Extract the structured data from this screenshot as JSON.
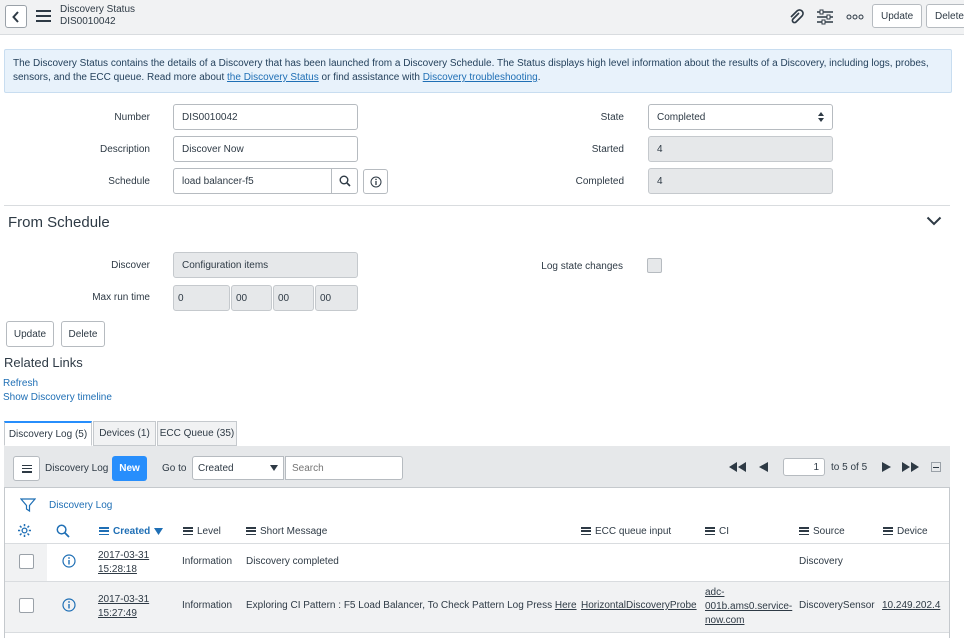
{
  "header": {
    "title": "Discovery Status",
    "subtitle": "DIS0010042",
    "update_label": "Update",
    "delete_label": "Delete"
  },
  "info": {
    "text_1": "The Discovery Status contains the details of a Discovery that has been launched from a Discovery Schedule. The Status displays high level information about the results of a Discovery, including logs, probes, sensors, and the ECC queue. Read more about ",
    "link_1": "the Discovery Status",
    "text_2": " or find assistance with ",
    "link_2": "Discovery troubleshooting",
    "text_3": "."
  },
  "form": {
    "number_label": "Number",
    "number_value": "DIS0010042",
    "description_label": "Description",
    "description_value": "Discover Now",
    "schedule_label": "Schedule",
    "schedule_value": "load balancer-f5",
    "state_label": "State",
    "state_value": "Completed",
    "started_label": "Started",
    "started_value": "4",
    "completed_label": "Completed",
    "completed_value": "4"
  },
  "schedule_section": {
    "title": "From Schedule",
    "discover_label": "Discover",
    "discover_value": "Configuration items",
    "log_state_label": "Log state changes",
    "max_run_label": "Max run time",
    "max_run_days": "0",
    "max_run_hours": "00",
    "max_run_minutes": "00",
    "max_run_seconds": "00"
  },
  "bottom_buttons": {
    "update": "Update",
    "delete": "Delete"
  },
  "related_links": {
    "title": "Related Links",
    "refresh": "Refresh",
    "timeline": "Show Discovery timeline"
  },
  "tabs": [
    "Discovery Log (5)",
    "Devices (1)",
    "ECC Queue (35)"
  ],
  "list": {
    "title": "Discovery Log",
    "new_label": "New",
    "goto_label": "Go to",
    "goto_field": "Created",
    "search_placeholder": "Search",
    "page_value": "1",
    "page_of": "to 5 of 5",
    "breadcrumb": "Discovery Log",
    "columns": [
      "Created",
      "Level",
      "Short Message",
      "ECC queue input",
      "CI",
      "Source",
      "Device"
    ],
    "rows": [
      {
        "created_date": "2017-03-31",
        "created_time": "15:28:18",
        "level": "Information",
        "message": "Discovery completed",
        "message_link": "",
        "ecc": "",
        "ci_1": "",
        "ci_2": "",
        "ci_3": "",
        "source": "Discovery",
        "device": ""
      },
      {
        "created_date": "2017-03-31",
        "created_time": "15:27:49",
        "level": "Information",
        "message": "Exploring CI Pattern : F5 Load Balancer, To Check Pattern Log Press ",
        "message_link": "Here",
        "ecc": "HorizontalDiscoveryProbe",
        "ci_1": "adc-",
        "ci_2": "001b.ams0.service-",
        "ci_3": "now.com",
        "source": "DiscoverySensor",
        "device": "10.249.202.4"
      }
    ]
  },
  "colors": {
    "accent": "#278efc",
    "link": "#1f6fb5",
    "info_bg": "#e8f2fb"
  }
}
